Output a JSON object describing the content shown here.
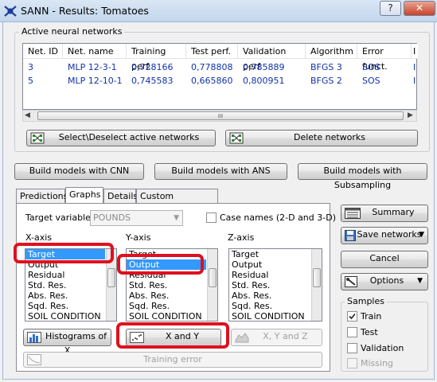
{
  "window": {
    "title": "SANN - Results: Tomatoes",
    "help": "?",
    "close": "✕"
  },
  "networks": {
    "group_label": "Active neural networks",
    "columns": [
      "Net. ID",
      "Net. name",
      "Training perf.",
      "Test perf.",
      "Validation perf.",
      "Algorithm",
      "Error funct.",
      "I"
    ],
    "rows": [
      [
        "3",
        "MLP 12-3-1",
        "0,728166",
        "0,778808",
        "0,785889",
        "BFGS 3",
        "SOS",
        "I"
      ],
      [
        "5",
        "MLP 12-10-1",
        "0,745583",
        "0,665860",
        "0,800951",
        "BFGS 2",
        "SOS",
        "I"
      ]
    ],
    "scroll_grip": "III",
    "select_btn": "Select\\Deselect active networks",
    "delete_btn": "Delete networks"
  },
  "build": {
    "cnn": "Build models with CNN",
    "ans": "Build models with ANS",
    "sub": "Build models with Subsampling"
  },
  "tabs": [
    "Predictions",
    "Graphs",
    "Details",
    "Custom predictions"
  ],
  "graphs": {
    "target_label": "Target variable:",
    "target_value": "POUNDS",
    "case_names_label": "Case names (2-D and 3-D)",
    "x_label": "X-axis",
    "y_label": "Y-axis",
    "z_label": "Z-axis",
    "x_items": [
      "Target",
      "Output",
      "Residual",
      "Std. Res.",
      "Abs. Res.",
      "Sqd. Res.",
      "SOIL CONDITION"
    ],
    "y_items": [
      "Target",
      "Output",
      "Residual",
      "Std. Res.",
      "Abs. Res.",
      "Sqd. Res.",
      "SOIL CONDITION"
    ],
    "z_items": [
      "Target",
      "Output",
      "Residual",
      "Std. Res.",
      "Abs. Res.",
      "Sqd. Res.",
      "SOIL CONDITION"
    ],
    "hist_btn": "Histograms of X",
    "xy_btn": "X and Y",
    "xyz_btn": "X, Y and Z",
    "train_err_btn": "Training error"
  },
  "side": {
    "summary": "Summary",
    "save": "Save networks",
    "cancel": "Cancel",
    "options": "Options",
    "samples_label": "Samples",
    "train": "Train",
    "test": "Test",
    "validation": "Validation",
    "missing": "Missing"
  }
}
